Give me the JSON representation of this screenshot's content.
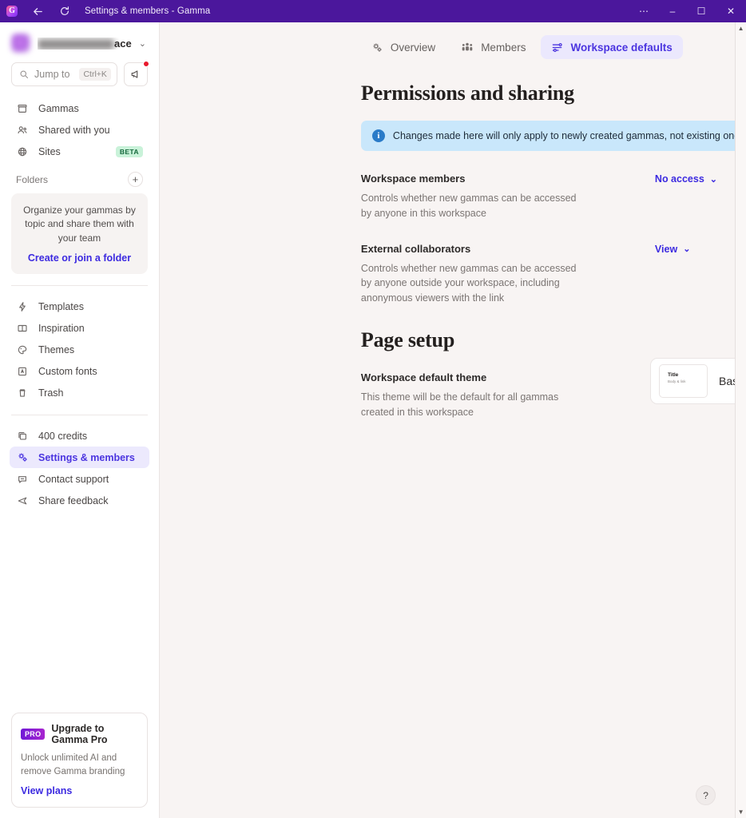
{
  "titlebar": {
    "logo": "gamma-logo-icon",
    "back": "back-arrow-icon",
    "refresh": "refresh-icon",
    "title": "Settings & members - Gamma",
    "more": "⋯",
    "minimize": "–",
    "maximize": "☐",
    "close": "✕",
    "bg_color": "#4b179c"
  },
  "sidebar": {
    "workspace": {
      "name_visible": "ace",
      "caret": "⌄"
    },
    "search": {
      "placeholder": "Jump to",
      "shortcut": "Ctrl+K"
    },
    "announce_button": "megaphone-icon",
    "nav_primary": [
      {
        "label": "Gammas",
        "icon": "archive-icon"
      },
      {
        "label": "Shared with you",
        "icon": "people-icon"
      },
      {
        "label": "Sites",
        "icon": "globe-icon",
        "badge": "BETA"
      }
    ],
    "folders": {
      "label": "Folders",
      "add": "+",
      "empty_text": "Organize your gammas by topic and share them with your team",
      "cta": "Create or join a folder"
    },
    "nav_secondary": [
      {
        "label": "Templates",
        "icon": "lightning-icon"
      },
      {
        "label": "Inspiration",
        "icon": "book-icon"
      },
      {
        "label": "Themes",
        "icon": "palette-icon"
      },
      {
        "label": "Custom fonts",
        "icon": "font-icon"
      },
      {
        "label": "Trash",
        "icon": "trash-icon"
      }
    ],
    "nav_tertiary": [
      {
        "label": "400 credits",
        "icon": "coins-icon",
        "active": false
      },
      {
        "label": "Settings & members",
        "icon": "gears-icon",
        "active": true
      },
      {
        "label": "Contact support",
        "icon": "chat-icon",
        "active": false
      },
      {
        "label": "Share feedback",
        "icon": "send-icon",
        "active": false
      }
    ],
    "upgrade": {
      "badge": "PRO",
      "title": "Upgrade to Gamma Pro",
      "description": "Unlock unlimited AI and remove Gamma branding",
      "link": "View plans"
    }
  },
  "main": {
    "tabs": [
      {
        "label": "Overview",
        "icon": "gears-icon",
        "active": false
      },
      {
        "label": "Members",
        "icon": "people-group-icon",
        "active": false
      },
      {
        "label": "Workspace defaults",
        "icon": "sliders-icon",
        "active": true
      }
    ],
    "permissions": {
      "heading": "Permissions and sharing",
      "banner": {
        "icon": "info-icon",
        "text": "Changes made here will only apply to newly created gammas, not existing ones"
      },
      "settings": [
        {
          "name": "Workspace members",
          "description": "Controls whether new gammas can be accessed by anyone in this workspace",
          "value": "No access",
          "caret": "⌄"
        },
        {
          "name": "External collaborators",
          "description": "Controls whether new gammas can be accessed by anyone outside your workspace, including anonymous viewers with the link",
          "value": "View",
          "caret": "⌄"
        }
      ]
    },
    "page_setup": {
      "heading": "Page setup",
      "theme": {
        "name": "Workspace default theme",
        "description": "This theme will be the default for all gammas created in this workspace",
        "selected": "Basic Light",
        "thumb_title": "Title",
        "thumb_body": "Body & link",
        "caret": "⌄"
      }
    },
    "help_button": "?"
  },
  "scrollbar": {
    "up": "▲",
    "down": "▼"
  },
  "colors": {
    "accent": "#4b35e0",
    "link": "#3c2ae0",
    "titlebar": "#4b179c",
    "banner": "#c9e7fb",
    "beta_badge_bg": "#c9f2d9",
    "main_bg": "#f8f4f3"
  }
}
